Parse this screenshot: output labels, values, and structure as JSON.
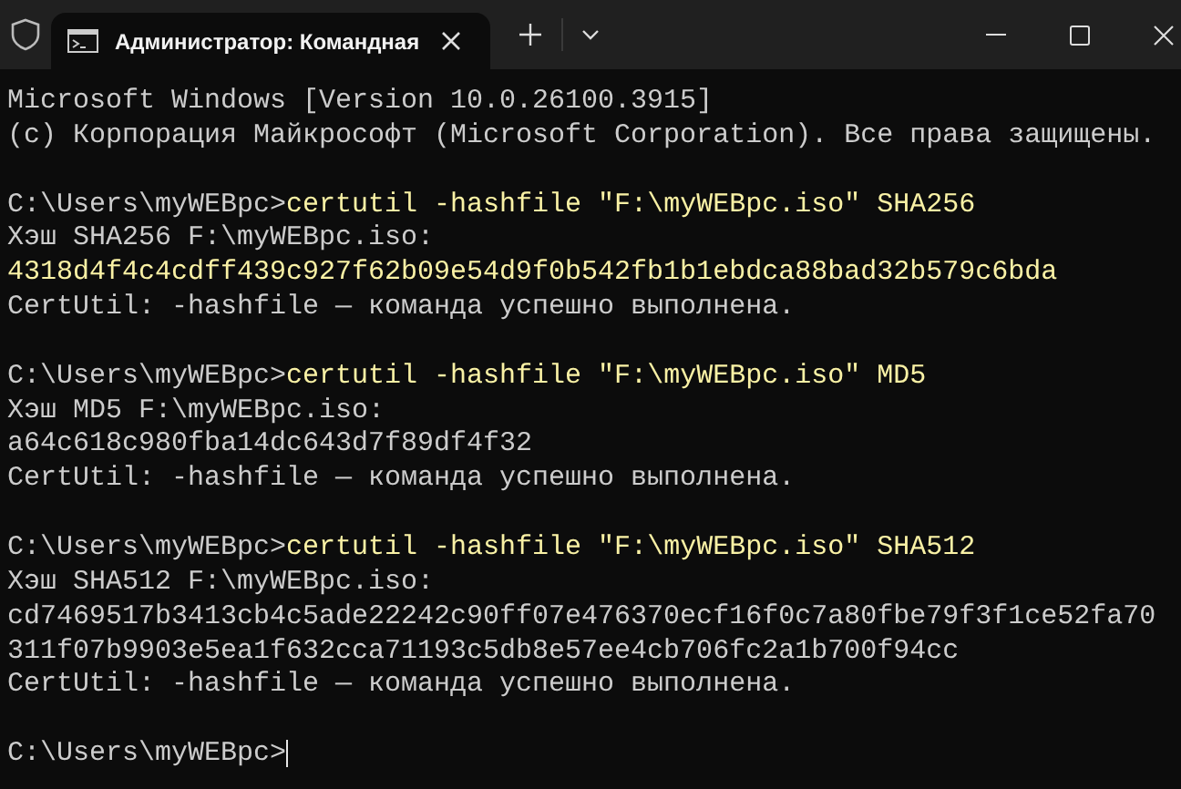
{
  "window": {
    "tab_title": "Администратор: Командная"
  },
  "console": {
    "lines": [
      {
        "segments": [
          {
            "text": "Microsoft Windows [Version 10.0.26100.3915]",
            "kind": "output"
          }
        ]
      },
      {
        "segments": [
          {
            "text": "(c) Корпорация Майкрософт (Microsoft Corporation). Все права защищены.",
            "kind": "output"
          }
        ]
      },
      {
        "blank_before": true,
        "segments": [
          {
            "text": "C:\\Users\\myWEBpc>",
            "kind": "prompt"
          },
          {
            "text": "certutil -hashfile \"F:\\myWEBpc.iso\" SHA256",
            "kind": "command"
          }
        ]
      },
      {
        "segments": [
          {
            "text": "Хэш SHA256 F:\\myWEBpc.iso:",
            "kind": "output"
          }
        ]
      },
      {
        "segments": [
          {
            "text": "4318d4f4c4cdff439c927f62b09e54d9f0b542fb1b1ebdca88bad32b579c6bda",
            "kind": "highlight"
          }
        ]
      },
      {
        "segments": [
          {
            "text": "CertUtil: -hashfile — команда успешно выполнена.",
            "kind": "output"
          }
        ]
      },
      {
        "blank_before": true,
        "segments": [
          {
            "text": "C:\\Users\\myWEBpc>",
            "kind": "prompt"
          },
          {
            "text": "certutil -hashfile \"F:\\myWEBpc.iso\" MD5",
            "kind": "command"
          }
        ]
      },
      {
        "segments": [
          {
            "text": "Хэш MD5 F:\\myWEBpc.iso:",
            "kind": "output"
          }
        ]
      },
      {
        "segments": [
          {
            "text": "a64c618c980fba14dc643d7f89df4f32",
            "kind": "output"
          }
        ]
      },
      {
        "segments": [
          {
            "text": "CertUtil: -hashfile — команда успешно выполнена.",
            "kind": "output"
          }
        ]
      },
      {
        "blank_before": true,
        "segments": [
          {
            "text": "C:\\Users\\myWEBpc>",
            "kind": "prompt"
          },
          {
            "text": "certutil -hashfile \"F:\\myWEBpc.iso\" SHA512",
            "kind": "command"
          }
        ]
      },
      {
        "segments": [
          {
            "text": "Хэш SHA512 F:\\myWEBpc.iso:",
            "kind": "output"
          }
        ]
      },
      {
        "segments": [
          {
            "text": "cd7469517b3413cb4c5ade22242c90ff07e476370ecf16f0c7a80fbe79f3f1ce52fa70",
            "kind": "output"
          }
        ]
      },
      {
        "segments": [
          {
            "text": "311f07b9903e5ea1f632cca71193c5db8e57ee4cb706fc2a1b700f94cc",
            "kind": "output"
          }
        ]
      },
      {
        "segments": [
          {
            "text": "CertUtil: -hashfile — команда успешно выполнена.",
            "kind": "output"
          }
        ]
      },
      {
        "blank_before": true,
        "segments": [
          {
            "text": "C:\\Users\\myWEBpc>",
            "kind": "prompt"
          }
        ]
      }
    ]
  }
}
